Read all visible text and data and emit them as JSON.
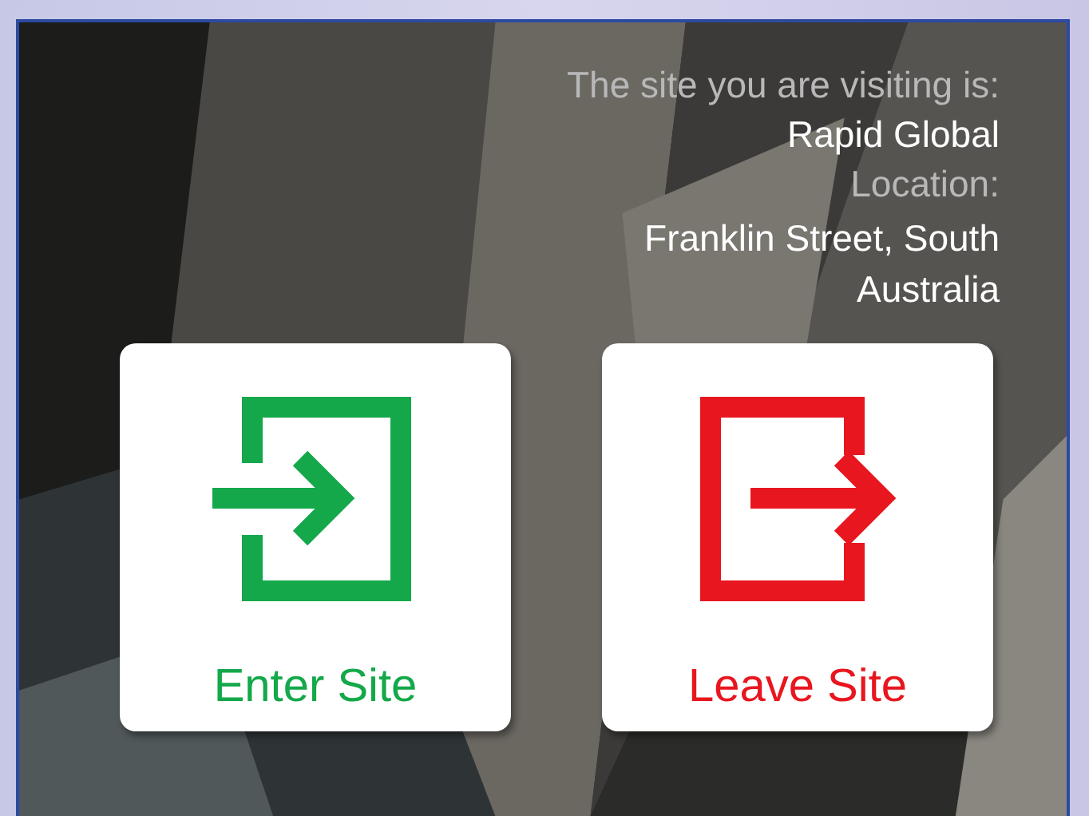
{
  "site_info": {
    "site_label": "The site you are visiting is:",
    "site_name": "Rapid Global",
    "location_label": "Location:",
    "location": "Franklin Street, South Australia"
  },
  "actions": [
    {
      "kind": "enter",
      "label": "Enter Site",
      "color": "#14a84a"
    },
    {
      "kind": "leave",
      "label": "Leave Site",
      "color": "#e8161f"
    }
  ]
}
